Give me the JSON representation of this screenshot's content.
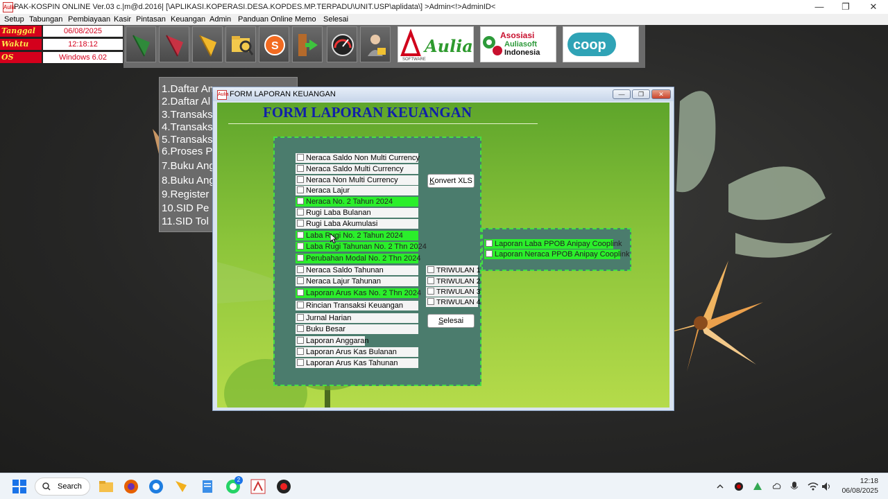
{
  "window": {
    "title": "PAK-KOSPIN ONLINE Ver.03 c.|m@d.2016| [\\APLIKASI.KOPERASI.DESA.KOPDES.MP.TERPADU\\UNIT.USP\\aplidata\\] >Admin<!>AdminID<",
    "icon_text": "Aulia",
    "controls": {
      "minimize": "—",
      "restore": "❐",
      "close": "✕"
    }
  },
  "menu": [
    "Setup",
    "Tabungan",
    "Pembiayaan",
    "Kasir",
    "Pintasan",
    "Keuangan",
    "Admin",
    "Panduan Online",
    "Memo",
    "Selesai"
  ],
  "info": {
    "tanggal_label": "Tanggal",
    "tanggal_value": "06/08/2025",
    "waktu_label": "Waktu",
    "waktu_value": "12:18:12",
    "os_label": "OS",
    "os_value": "Windows 6.02"
  },
  "toolbar_icons": [
    "green-leaf-icon",
    "red-leaf-icon",
    "yellow-leaf-icon",
    "folder-search-icon",
    "s-coin-icon",
    "exit-door-icon",
    "speedometer-icon",
    "user-lock-icon"
  ],
  "logos": {
    "aulia_text": "Aulia",
    "aulia_sub": "SOFTWARE",
    "asosiasi_line1": "Asosiasi",
    "asosiasi_line2": "Auliasoft",
    "asosiasi_line3": "Indonesia",
    "coop_text": "coop"
  },
  "bg_menu": [
    "1.Daftar An",
    "2.Daftar Al",
    "3.Transaks",
    "4.Transaks",
    "5.Transaks",
    "6.Proses P",
    "7.Buku Ang",
    "8.Buku Ang",
    "9.Register",
    "10.SID Pe",
    "11.SID Tol"
  ],
  "form": {
    "title": "FORM LAPORAN KEUANGAN",
    "heading": "FORM LAPORAN KEUANGAN",
    "reports": [
      {
        "label": "Neraca Saldo Non Multi Currency",
        "style": "white"
      },
      {
        "label": "Neraca Saldo Multi Currency",
        "style": "white"
      },
      {
        "label": "Neraca Non Multi Currency",
        "style": "white"
      },
      {
        "label": "Neraca Lajur",
        "style": "white"
      },
      {
        "label": "Neraca No. 2 Tahun 2024",
        "style": "green"
      },
      {
        "label": "Rugi Laba Bulanan",
        "style": "white"
      },
      {
        "label": "Rugi Laba Akumulasi",
        "style": "white"
      },
      {
        "label": "Laba Rugi No. 2 Tahun 2024",
        "style": "green"
      },
      {
        "label": "Laba Rugi Tahunan No. 2 Thn 2024",
        "style": "green"
      },
      {
        "label": "Perubahan Modal No. 2 Thn 2024",
        "style": "green"
      },
      {
        "label": "Neraca Saldo Tahunan",
        "style": "white"
      },
      {
        "label": "Neraca Lajur Tahunan",
        "style": "white"
      },
      {
        "label": "Laporan Arus Kas No. 2 Thn 2024",
        "style": "green"
      },
      {
        "label": "Rincian Transaksi Keuangan",
        "style": "white"
      },
      {
        "label": "Jurnal Harian",
        "style": "white"
      },
      {
        "label": "Buku Besar",
        "style": "white"
      },
      {
        "label": "Laporan Anggaran",
        "style": "white"
      },
      {
        "label": "Laporan Arus Kas Bulanan",
        "style": "white"
      },
      {
        "label": "Laporan Arus Kas Tahunan",
        "style": "white"
      }
    ],
    "triwulan": [
      "TRIWULAN 1",
      "TRIWULAN 2",
      "TRIWULAN 3",
      "TRIWULAN 4"
    ],
    "konvert_prefix": "K",
    "konvert_rest": "onvert XLS",
    "selesai_prefix": "S",
    "selesai_rest": "elesai",
    "ppob": [
      "Laporan Laba PPOB Anipay Cooplink",
      "Laporan Neraca PPOB Anipay Cooplink"
    ]
  },
  "taskbar": {
    "search_label": "Search",
    "whatsapp_badge": "2",
    "time": "12:18",
    "date": "06/08/2025"
  }
}
